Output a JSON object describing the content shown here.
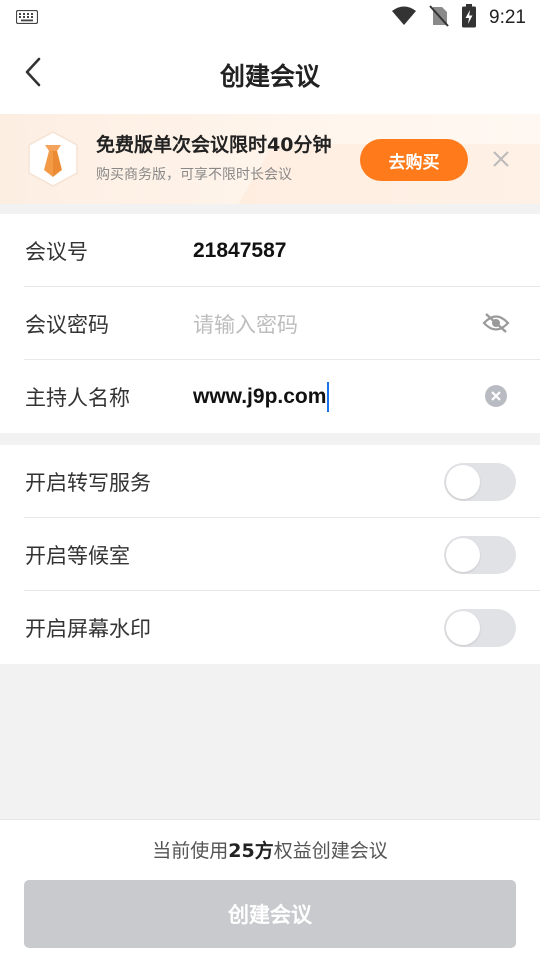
{
  "status_bar": {
    "time": "9:21",
    "icons": [
      "keyboard-icon",
      "wifi-icon",
      "no-sim-icon",
      "battery-charging-icon"
    ]
  },
  "header": {
    "title": "创建会议",
    "back_icon": "chevron-left-icon"
  },
  "promo": {
    "title": "免费版单次会议限时40分钟",
    "subtitle": "购买商务版，可享不限时长会议",
    "button_label": "去购买",
    "badge_icon": "necktie-icon",
    "close_icon": "close-icon"
  },
  "meeting": {
    "id_label": "会议号",
    "id_value": "21847587",
    "password_label": "会议密码",
    "password_placeholder": "请输入密码",
    "password_icon": "eye-off-icon",
    "host_label": "主持人名称",
    "host_value": "www.j9p.com",
    "host_clear_icon": "clear-icon"
  },
  "options": [
    {
      "label": "开启转写服务",
      "enabled": false
    },
    {
      "label": "开启等候室",
      "enabled": false
    },
    {
      "label": "开启屏幕水印",
      "enabled": false
    }
  ],
  "footer": {
    "quota_prefix": "当前使用",
    "quota_value": "25方",
    "quota_suffix": "权益创建会议",
    "create_label": "创建会议"
  },
  "colors": {
    "accent": "#ff7a1a",
    "disabled_button": "#c9cacd",
    "toggle_off": "#e1e2e5",
    "caret": "#1a73e8"
  }
}
